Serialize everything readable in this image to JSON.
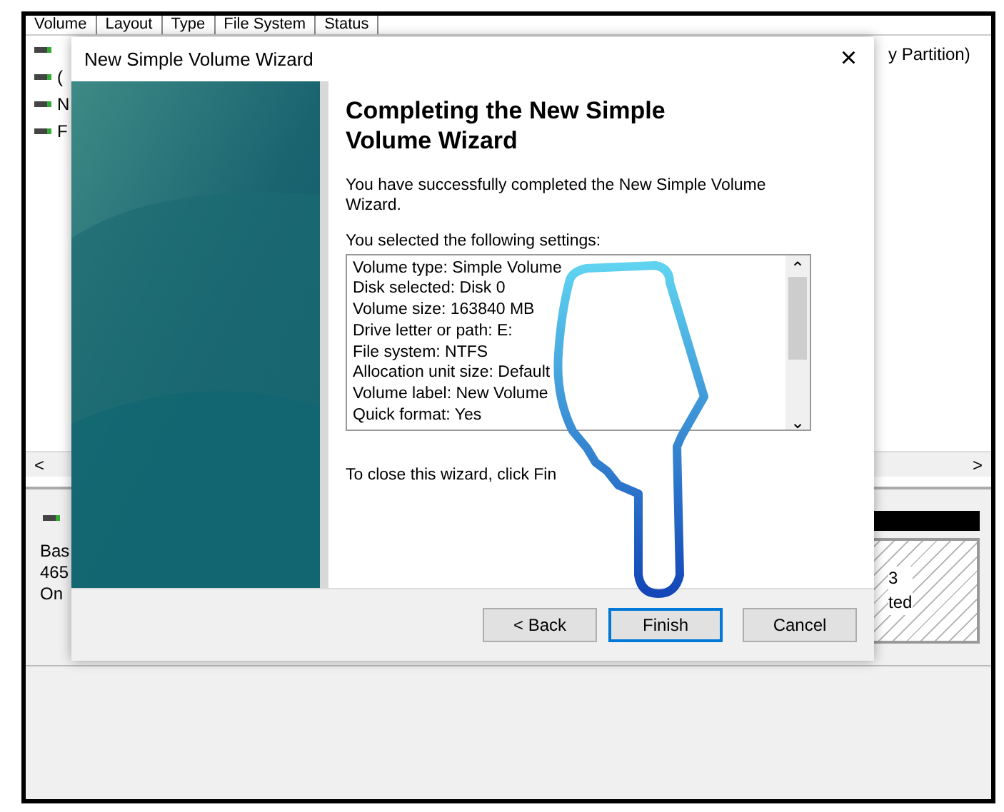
{
  "background_window": {
    "columns": [
      "Volume",
      "Layout",
      "Type",
      "File System",
      "Status"
    ],
    "volume_rows": [
      {
        "text": ""
      },
      {
        "text": "("
      },
      {
        "text": "N"
      },
      {
        "text": "F"
      }
    ],
    "partition_text": "y Partition)",
    "disk_labels": [
      "Bas",
      "465",
      "On"
    ],
    "partition_labels": [
      "3",
      "ted"
    ]
  },
  "dialog": {
    "title": "New Simple Volume Wizard",
    "close": "×",
    "heading": "Completing the New Simple Volume Wizard",
    "intro": "You have successfully completed the New Simple Volume Wizard.",
    "settings_label": "You selected the following settings:",
    "settings": [
      "Volume type: Simple Volume",
      "Disk selected: Disk 0",
      "Volume size: 163840 MB",
      "Drive letter or path: E:",
      "File system: NTFS",
      "Allocation unit size: Default",
      "Volume label: New Volume",
      "Quick format: Yes"
    ],
    "scroll_up": "⌃",
    "scroll_down": "⌄",
    "closing": "To close this wizard, click Fin",
    "buttons": [
      {
        "label": "< Back",
        "default": false
      },
      {
        "label": "Finish",
        "default": true
      },
      {
        "label": "Cancel",
        "default": false
      }
    ]
  },
  "scrollbar": {
    "left": "<",
    "right": ">"
  }
}
